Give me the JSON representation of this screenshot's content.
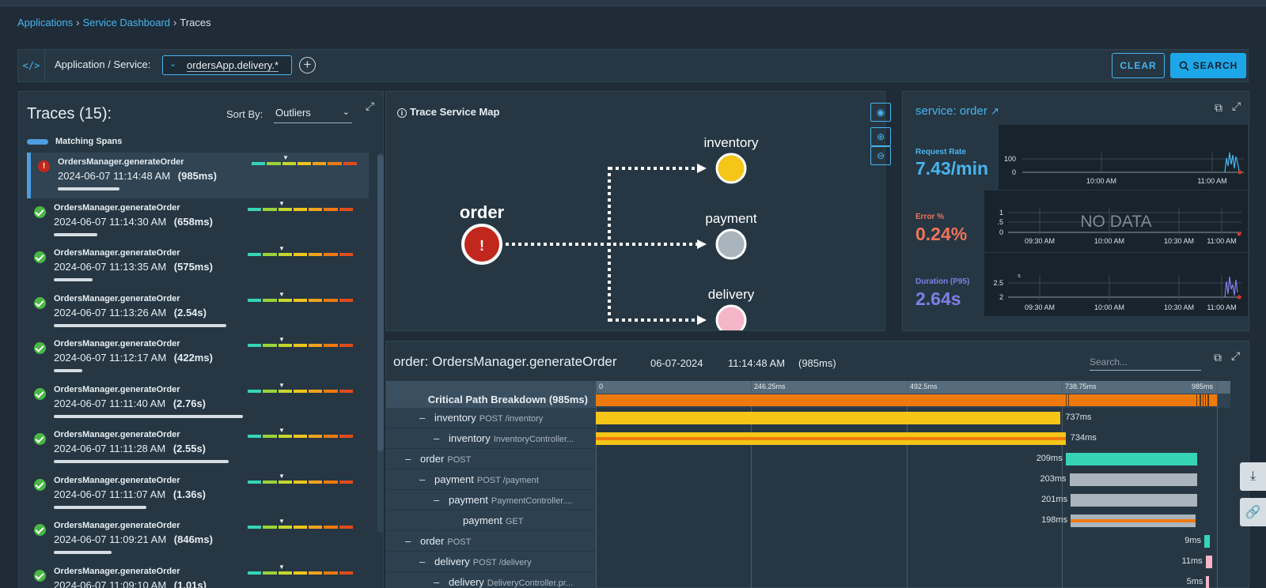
{
  "breadcrumb": {
    "items": [
      "Applications",
      "Service Dashboard"
    ],
    "current": "Traces"
  },
  "filter": {
    "code_icon": "</>",
    "label": "Application / Service:",
    "value": "ordersApp.delivery.*",
    "clear_label": "CLEAR",
    "search_label": "SEARCH"
  },
  "traces": {
    "title": "Traces (15):",
    "sort_label": "Sort By:",
    "sort_value": "Outliers",
    "legend_label": "Matching Spans",
    "items": [
      {
        "name": "OrdersManager.generateOrder",
        "date": "2024-06-07 11:14:48 AM",
        "duration": "(985ms)",
        "status": "error",
        "bar_fraction": 0.3
      },
      {
        "name": "OrdersManager.generateOrder",
        "date": "2024-06-07 11:14:30 AM",
        "duration": "(658ms)",
        "status": "ok",
        "bar_fraction": 0.21
      },
      {
        "name": "OrdersManager.generateOrder",
        "date": "2024-06-07 11:13:35 AM",
        "duration": "(575ms)",
        "status": "ok",
        "bar_fraction": 0.19
      },
      {
        "name": "OrdersManager.generateOrder",
        "date": "2024-06-07 11:13:26 AM",
        "duration": "(2.54s)",
        "status": "ok",
        "bar_fraction": 0.84
      },
      {
        "name": "OrdersManager.generateOrder",
        "date": "2024-06-07 11:12:17 AM",
        "duration": "(422ms)",
        "status": "ok",
        "bar_fraction": 0.14
      },
      {
        "name": "OrdersManager.generateOrder",
        "date": "2024-06-07 11:11:40 AM",
        "duration": "(2.76s)",
        "status": "ok",
        "bar_fraction": 0.92
      },
      {
        "name": "OrdersManager.generateOrder",
        "date": "2024-06-07 11:11:28 AM",
        "duration": "(2.55s)",
        "status": "ok",
        "bar_fraction": 0.85
      },
      {
        "name": "OrdersManager.generateOrder",
        "date": "2024-06-07 11:11:07 AM",
        "duration": "(1.36s)",
        "status": "ok",
        "bar_fraction": 0.45
      },
      {
        "name": "OrdersManager.generateOrder",
        "date": "2024-06-07 11:09:21 AM",
        "duration": "(846ms)",
        "status": "ok",
        "bar_fraction": 0.28
      },
      {
        "name": "OrdersManager.generateOrder",
        "date": "2024-06-07 11:09:10 AM",
        "duration": "(1.01s)",
        "status": "ok",
        "bar_fraction": 0.34
      }
    ]
  },
  "service_map": {
    "title": "Trace Service Map",
    "root": "order",
    "nodes": [
      "inventory",
      "payment",
      "delivery"
    ],
    "colors": {
      "order": "#c2271d",
      "inventory": "#f5c518",
      "payment": "#a9b4bc",
      "delivery": "#f4b6c8"
    }
  },
  "service_panel": {
    "title": "service: order",
    "metrics": [
      {
        "label": "Request Rate",
        "value": "7.43/min",
        "color": "#48b4ee",
        "y_ticks": [
          "100",
          "0"
        ],
        "x_ticks": [
          "10:00 AM",
          "11:00 AM"
        ],
        "nodata": ""
      },
      {
        "label": "Error %",
        "value": "0.24%",
        "color": "#f0735a",
        "y_ticks": [
          "1",
          ".5",
          "0"
        ],
        "x_ticks": [
          "09:30 AM",
          "10:00 AM",
          "10:30 AM",
          "11:00 AM"
        ],
        "nodata": "NO DATA"
      },
      {
        "label": "Duration (P95)",
        "value": "2.64s",
        "color": "#7f7fe6",
        "y_ticks": [
          "2.5",
          "2"
        ],
        "unit": "s",
        "x_ticks": [
          "09:30 AM",
          "10:00 AM",
          "10:30 AM",
          "11:00 AM"
        ],
        "nodata": ""
      }
    ]
  },
  "trace_detail": {
    "title": "order: OrdersManager.generateOrder",
    "date": "06-07-2024",
    "time": "11:14:48 AM",
    "duration": "(985ms)",
    "search_placeholder": "Search...",
    "axis_ticks": [
      "0",
      "246.25ms",
      "492.5ms",
      "738.75ms",
      "985ms"
    ],
    "total_ms": 985,
    "critical_label": "Critical Path Breakdown (985ms)",
    "spans": [
      {
        "indent": 1,
        "service": "inventory",
        "op": "POST /inventory",
        "start": 0,
        "end": 737,
        "label": "737ms",
        "label_side": "right",
        "color": "#f5c518",
        "stripe": ""
      },
      {
        "indent": 2,
        "service": "inventory",
        "op": "InventoryController...",
        "start": 0,
        "end": 745,
        "label": "734ms",
        "label_side": "right",
        "color": "#f5c518",
        "stripe": "#ef7a0c"
      },
      {
        "indent": 0,
        "service": "order",
        "op": "POST",
        "start": 745,
        "end": 954,
        "label": "209ms",
        "label_side": "left",
        "color": "#36d3b7",
        "stripe": ""
      },
      {
        "indent": 1,
        "service": "payment",
        "op": "POST /payment",
        "start": 751,
        "end": 954,
        "label": "203ms",
        "label_side": "left",
        "color": "#a9b4bc",
        "stripe": ""
      },
      {
        "indent": 2,
        "service": "payment",
        "op": "PaymentController....",
        "start": 753,
        "end": 954,
        "label": "201ms",
        "label_side": "left",
        "color": "#a9b4bc",
        "stripe": ""
      },
      {
        "indent": 3,
        "service": "payment",
        "op": "GET",
        "start": 753,
        "end": 951,
        "label": "198ms",
        "label_side": "left",
        "color": "#a9b4bc",
        "stripe": "#ef7a0c"
      },
      {
        "indent": 0,
        "service": "order",
        "op": "POST",
        "start": 965,
        "end": 974,
        "label": "9ms",
        "label_side": "left",
        "color": "#36d3b7",
        "stripe": ""
      },
      {
        "indent": 1,
        "service": "delivery",
        "op": "POST /delivery",
        "start": 967,
        "end": 978,
        "label": "11ms",
        "label_side": "left",
        "color": "#f4b6c8",
        "stripe": ""
      },
      {
        "indent": 2,
        "service": "delivery",
        "op": "DeliveryController.pr...",
        "start": 968,
        "end": 973,
        "label": "5ms",
        "label_side": "left",
        "color": "#f4b6c8",
        "stripe": ""
      }
    ]
  }
}
